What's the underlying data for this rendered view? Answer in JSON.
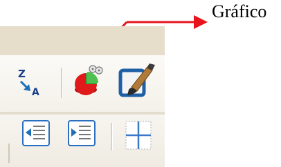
{
  "annotation": {
    "label": "Gráfico"
  },
  "toolbar": {
    "row1": [
      {
        "name": "sort-descending-button",
        "icon": "sort-z-a-icon",
        "letters_top": "Z",
        "letters_bottom": "A"
      },
      {
        "name": "chart-wizard-button",
        "icon": "pie-chart-icon"
      },
      {
        "name": "show-draw-functions-button",
        "icon": "paintbrush-icon"
      }
    ],
    "row2": [
      {
        "name": "decrease-indent-button",
        "icon": "decrease-indent-icon"
      },
      {
        "name": "increase-indent-button",
        "icon": "increase-indent-icon"
      },
      {
        "name": "borders-button",
        "icon": "borders-icon"
      }
    ]
  },
  "colors": {
    "arrow": "#e8131b",
    "toolbar_top": "#e6ddcb",
    "toolbar_bg": "#f7f5ef",
    "pie_red": "#e01a1a",
    "pie_green": "#3aa33a",
    "icon_blue": "#1f6fb8"
  }
}
